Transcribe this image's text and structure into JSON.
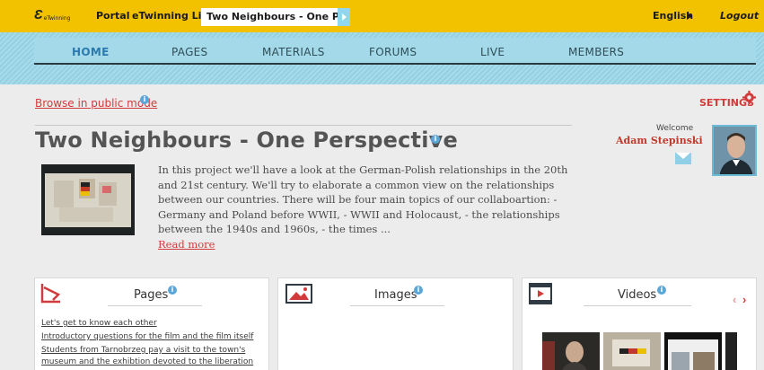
{
  "topbar": {
    "logo_mark": "Ɛ",
    "logo_text": "eTwinning",
    "portal": "Portal",
    "live": "eTwinning Live",
    "current_tab": "Two Neighbours - One Pers...",
    "language": "English",
    "logout": "Logout"
  },
  "nav": {
    "items": [
      "HOME",
      "PAGES",
      "MATERIALS",
      "FORUMS",
      "LIVE",
      "MEMBERS"
    ]
  },
  "browse_label": "Browse in public mode",
  "settings_label": "SETTINGS",
  "project": {
    "title": "Two Neighbours - One Perspective",
    "description": "In this project we'll have a look at the German-Polish relationships in the 20th and 21st century. We'll try to elaborate a common view on the relationships between our countries. There will be four main topics of our collaboartion: - Germany and Poland before WWII, - WWII and Holocaust, - the relationships between the 1940s and 1960s, - the times ...",
    "read_more": "Read more"
  },
  "user": {
    "welcome": "Welcome",
    "name": "Adam Stepinski"
  },
  "panels": {
    "pages": {
      "title": "Pages",
      "links": [
        "Let's get to know each other",
        "Introductory questions for the film and the film itself",
        "Students from Tarnobrzeg pay a visit to the town's",
        "museum and the exhibtion devoted to the liberation"
      ]
    },
    "images": {
      "title": "Images"
    },
    "videos": {
      "title": "Videos",
      "prev": "‹",
      "next": "›"
    }
  },
  "colors": {
    "topbar": "#f2c200",
    "accent_red": "#d23b3b",
    "info_blue": "#5ba6d9",
    "nav_active": "#2b7bb0"
  }
}
